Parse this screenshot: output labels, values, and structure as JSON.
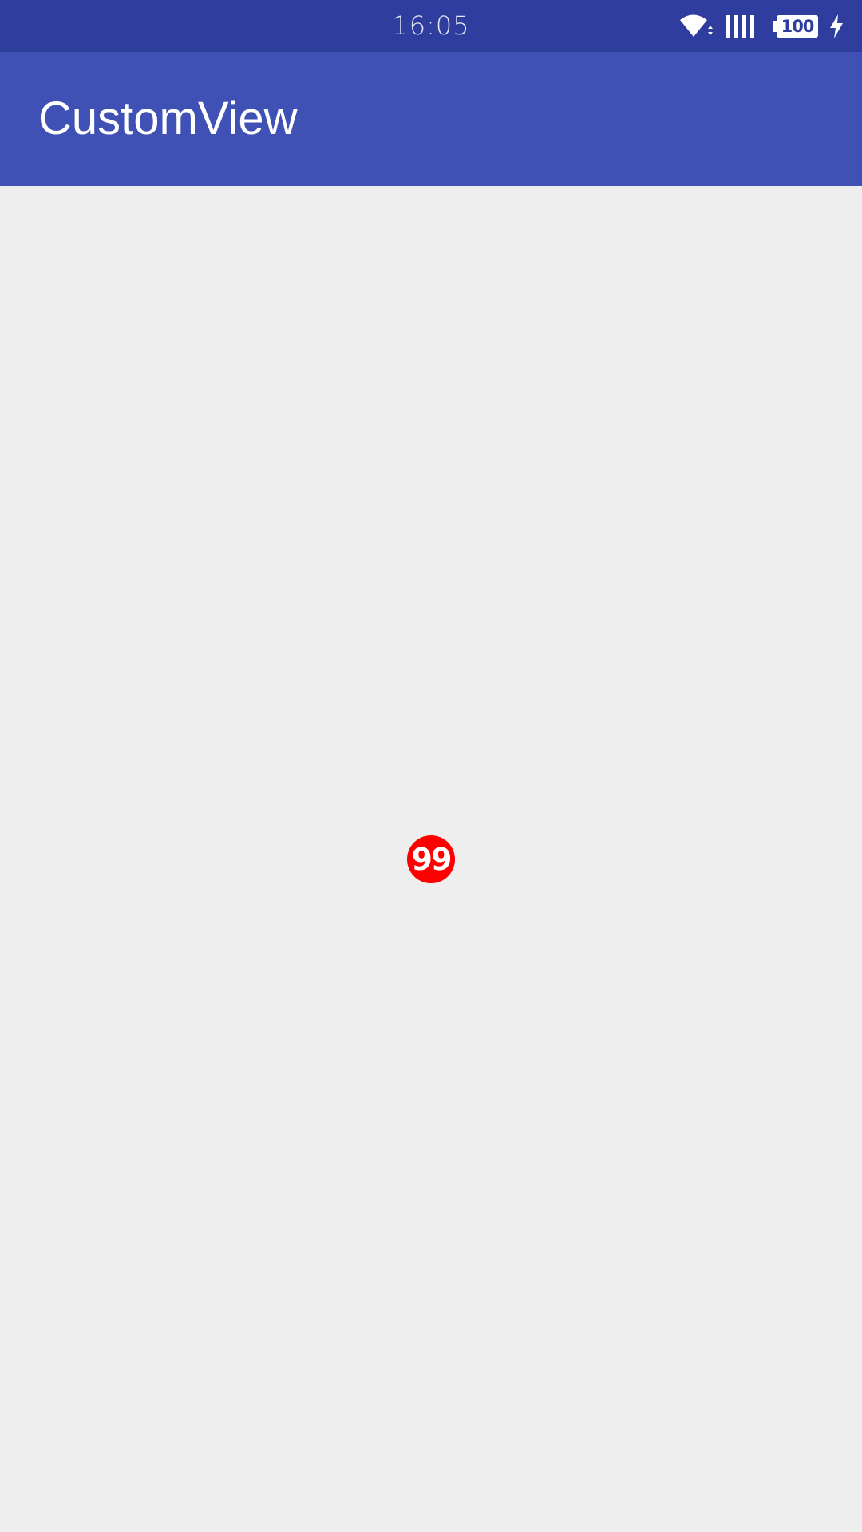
{
  "status_bar": {
    "time": "16:05",
    "battery_level": "100",
    "icons": [
      "wifi-icon",
      "signal-icon",
      "battery-icon",
      "charging-icon"
    ],
    "background": "#2f3e9e"
  },
  "app_bar": {
    "title": "CustomView",
    "background": "#3f51b5"
  },
  "content": {
    "badge_count": "99",
    "badge_color": "#ff0000",
    "background": "#eeeeee"
  }
}
